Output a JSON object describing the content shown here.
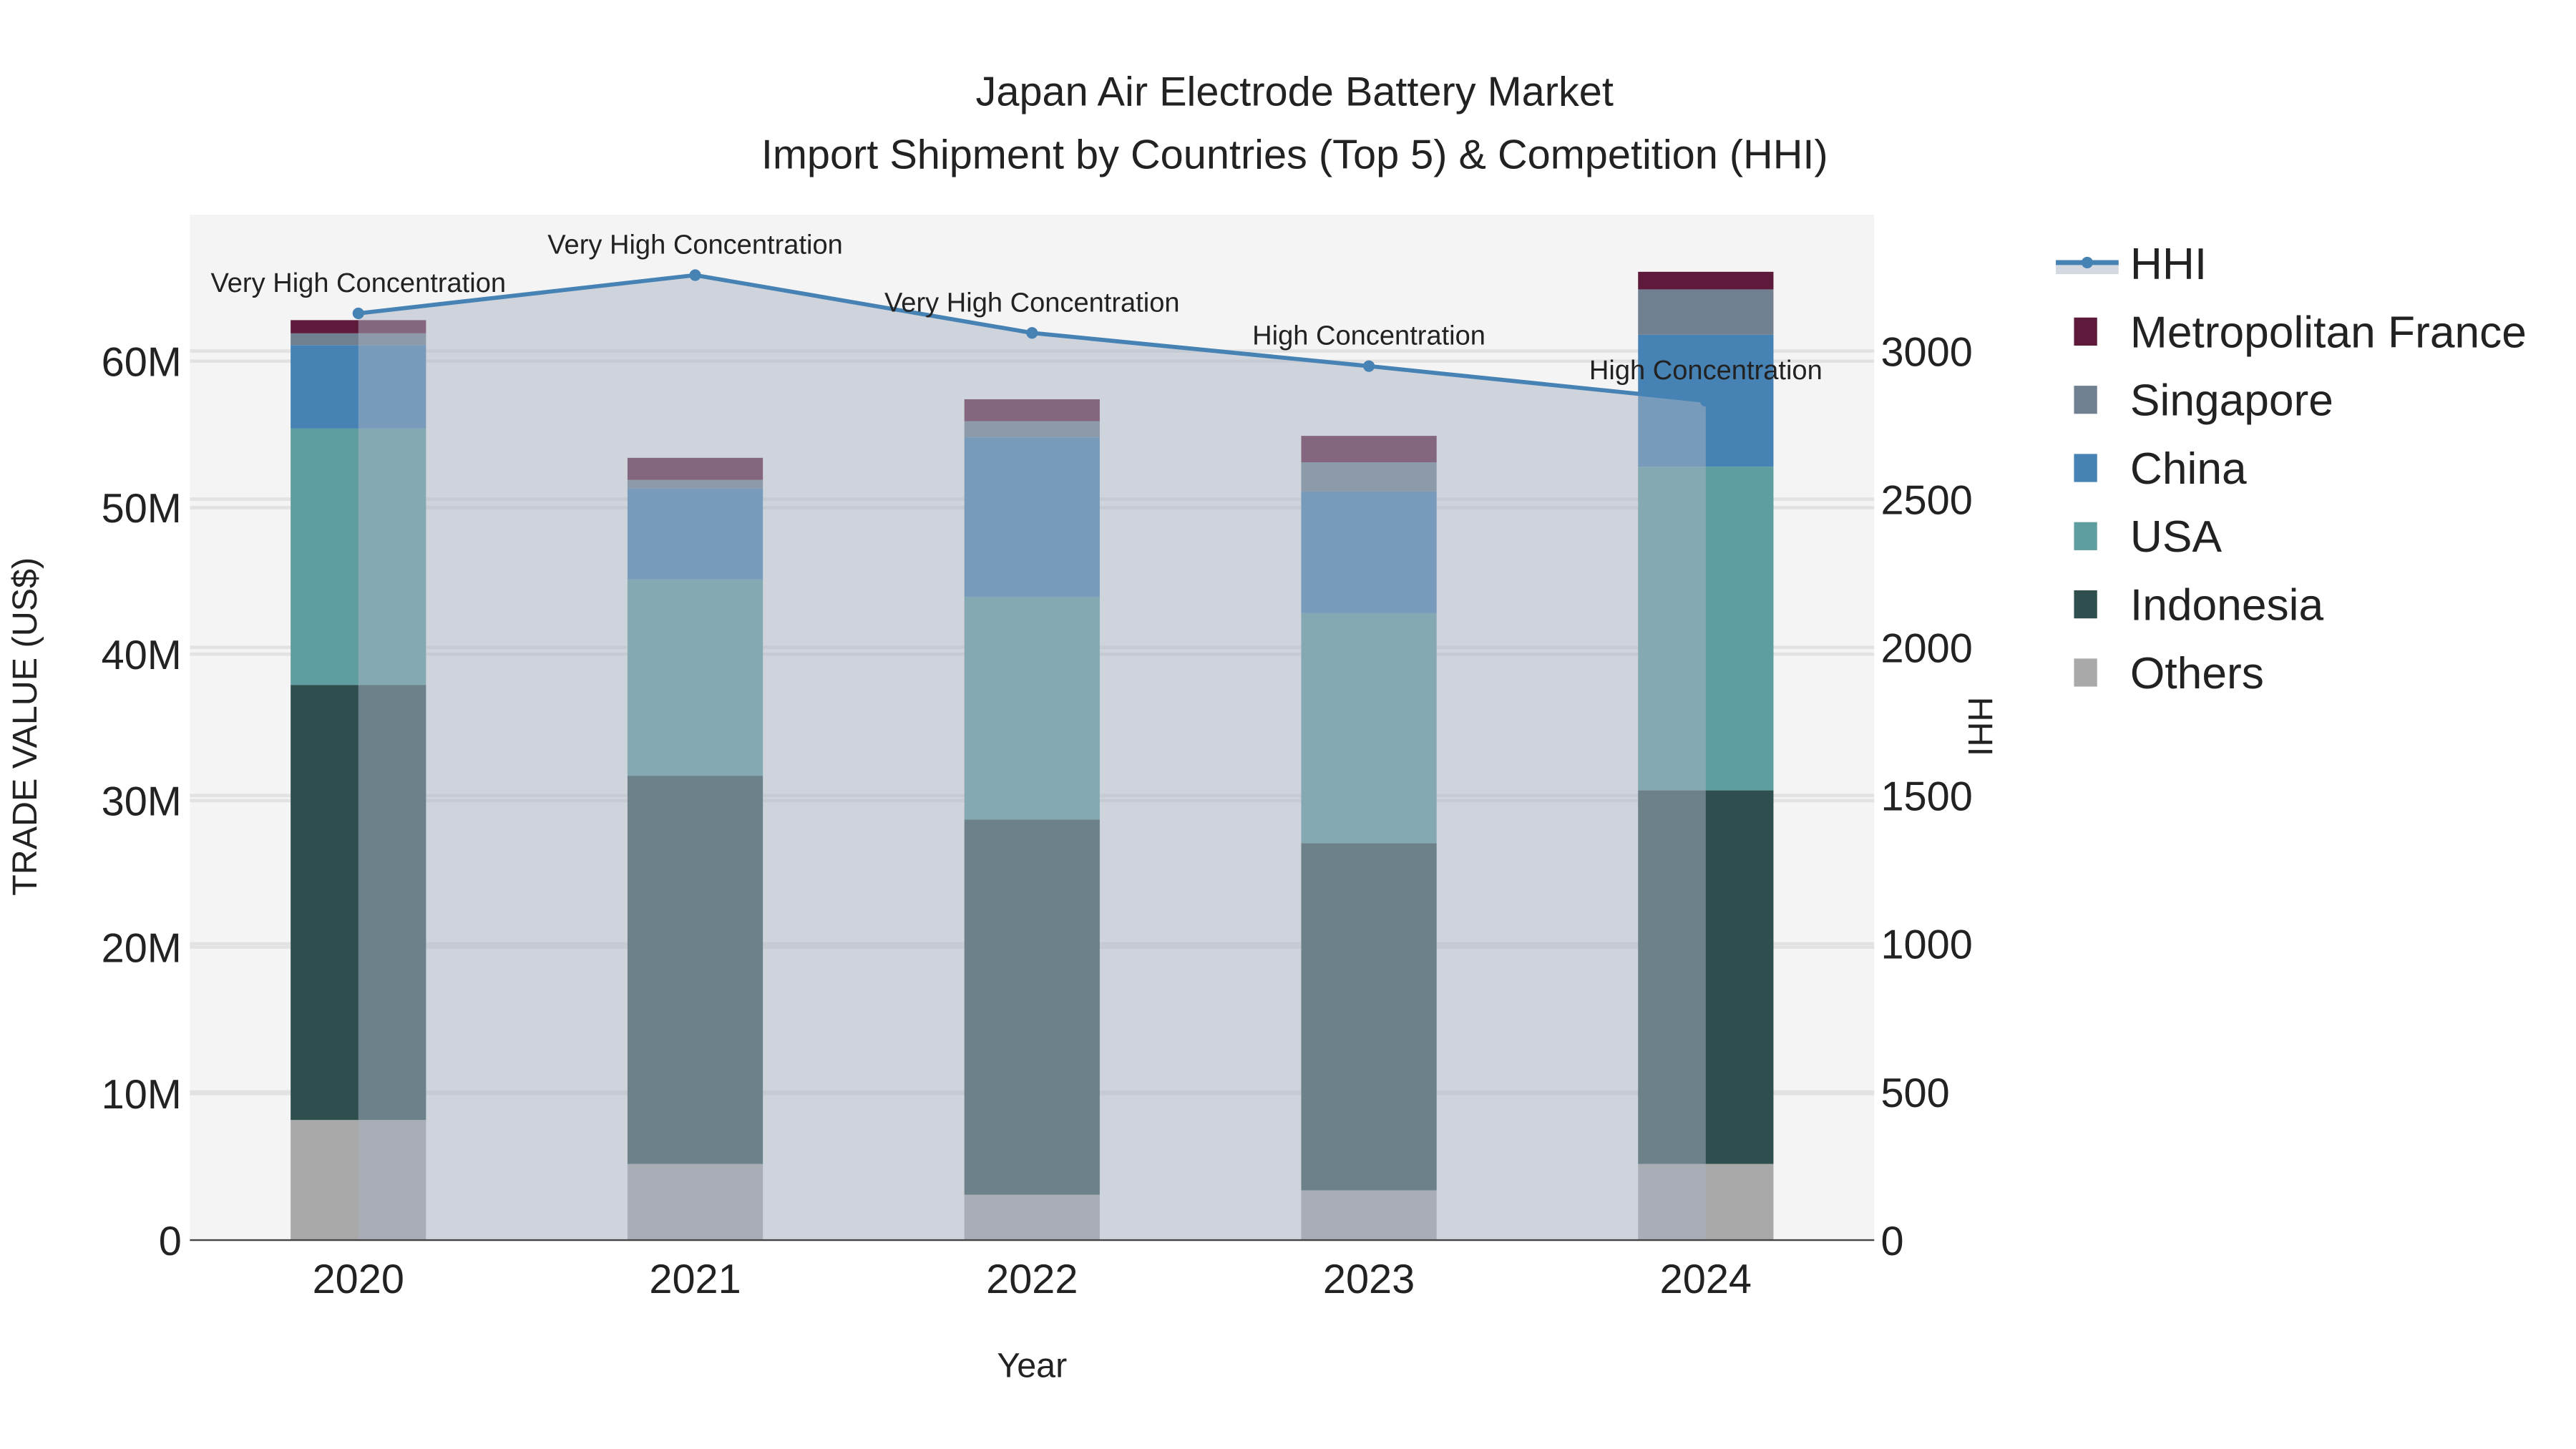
{
  "chart_data": {
    "type": "bar",
    "title": "Japan Air Electrode Battery Market",
    "subtitle": "Import Shipment by Countries (Top 5) & Competition (HHI)",
    "xlabel": "Year",
    "ylabel": "TRADE VALUE (US$)",
    "y2label": "HHI",
    "categories": [
      "2020",
      "2021",
      "2022",
      "2023",
      "2024"
    ],
    "ylim": [
      0,
      70000000
    ],
    "y_ticks": [
      0,
      10000000,
      20000000,
      30000000,
      40000000,
      50000000,
      60000000
    ],
    "y_tick_labels": [
      "0",
      "10M",
      "20M",
      "30M",
      "40M",
      "50M",
      "60M"
    ],
    "y2lim": [
      0,
      3460
    ],
    "y2_ticks": [
      0,
      500,
      1000,
      1500,
      2000,
      2500,
      3000
    ],
    "y2_tick_labels": [
      "0",
      "500",
      "1000",
      "1500",
      "2000",
      "2500",
      "3000"
    ],
    "stacked": true,
    "legend_position": "right",
    "series": [
      {
        "name": "Others",
        "color": "#a9a9a9",
        "values": [
          8200000,
          5200000,
          3100000,
          3400000,
          5200000
        ]
      },
      {
        "name": "Indonesia",
        "color": "#2f4f4f",
        "values": [
          29700000,
          26500000,
          25600000,
          23700000,
          25500000
        ]
      },
      {
        "name": "USA",
        "color": "#5f9ea0",
        "values": [
          17500000,
          13400000,
          15200000,
          15700000,
          22100000
        ]
      },
      {
        "name": "China",
        "color": "#4682b4",
        "values": [
          5700000,
          6200000,
          10900000,
          8300000,
          9000000
        ]
      },
      {
        "name": "Singapore",
        "color": "#708090",
        "values": [
          800000,
          600000,
          1100000,
          2000000,
          3100000
        ]
      },
      {
        "name": "Metropolitan France",
        "color": "#5e1a3a",
        "values": [
          900000,
          1500000,
          1500000,
          1800000,
          1200000
        ]
      }
    ],
    "line_series": {
      "name": "HHI",
      "color": "#4682b4",
      "fill": "#aab4c3",
      "values": [
        3127,
        3256,
        3061,
        2949,
        2832
      ],
      "annotations": [
        "Very High Concentration",
        "Very High Concentration",
        "Very High Concentration",
        "High Concentration",
        "High Concentration"
      ]
    },
    "legend_order": [
      "HHI",
      "Metropolitan France",
      "Singapore",
      "China",
      "USA",
      "Indonesia",
      "Others"
    ]
  }
}
